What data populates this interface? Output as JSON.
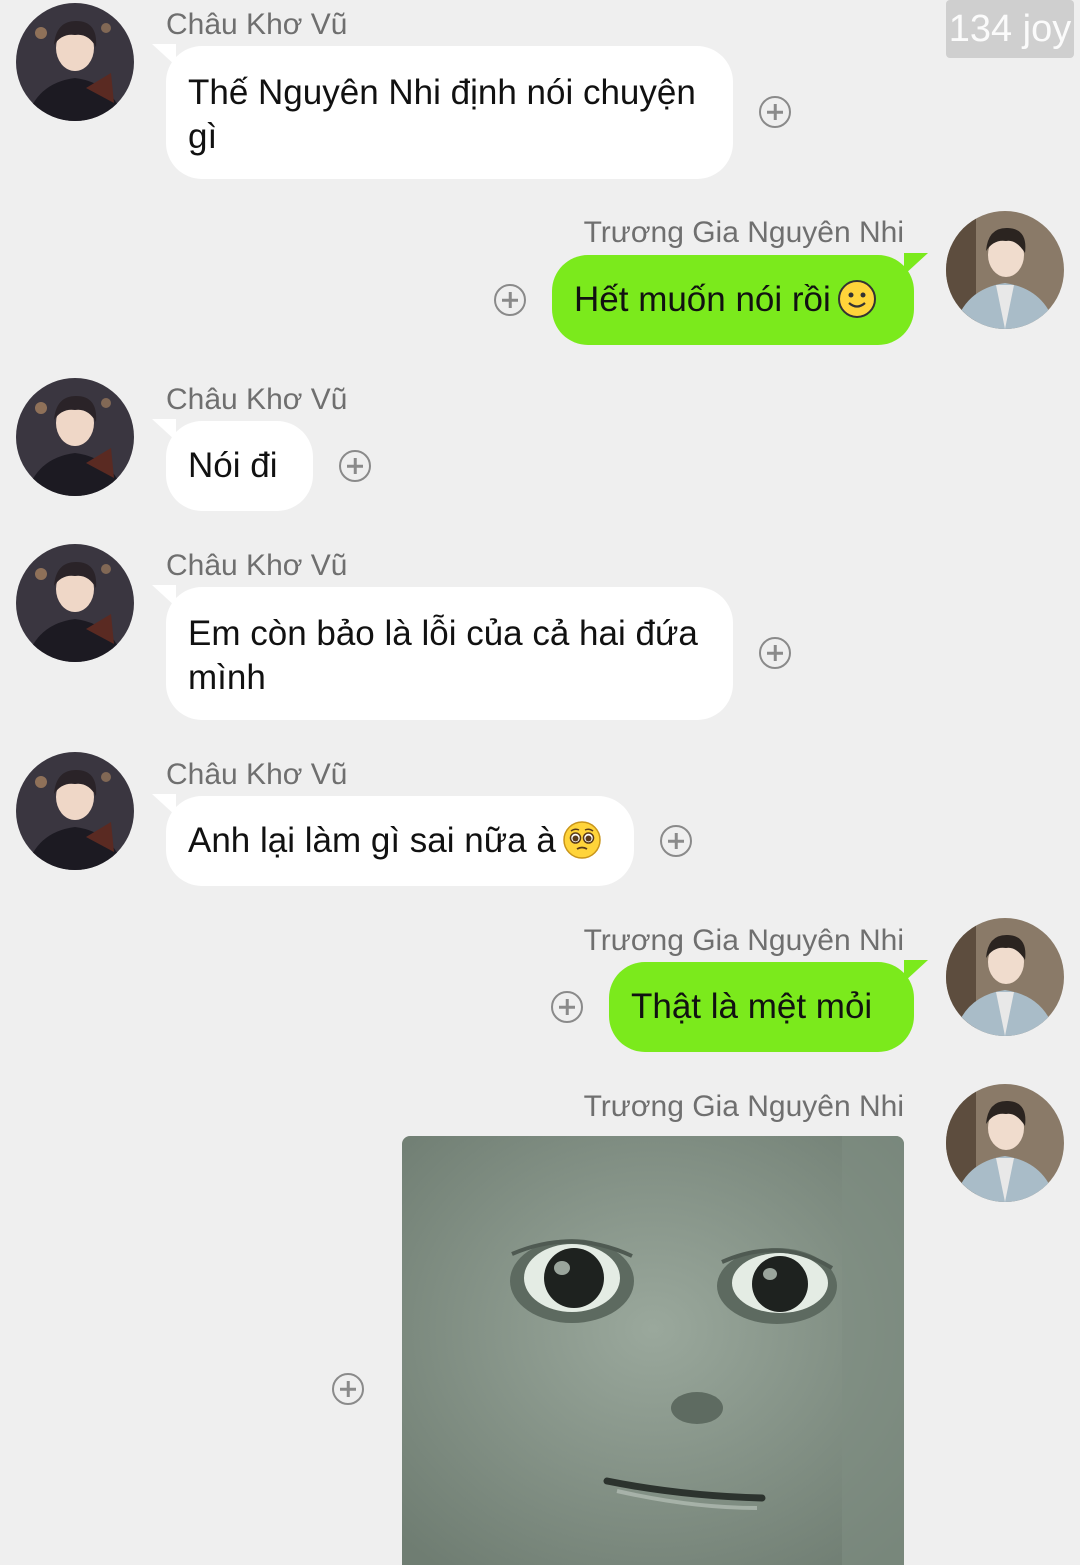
{
  "watermark": "134 joy",
  "contacts": {
    "left": {
      "name": "Châu Khơ Vũ",
      "avatar_icon": "profile-photo-dark-outfit"
    },
    "right": {
      "name": "Trương Gia Nguyên Nhi",
      "avatar_icon": "profile-photo-light-suit"
    }
  },
  "messages": [
    {
      "sender": "Châu Khơ Vũ",
      "side": "left",
      "text": "Thế Nguyên Nhi định nói chuyện gì"
    },
    {
      "sender": "Trương Gia Nguyên Nhi",
      "side": "right",
      "text": "Hết muốn nói rồi",
      "emoji": "slightly-smiling-face"
    },
    {
      "sender": "Châu Khơ Vũ",
      "side": "left",
      "text": "Nói đi"
    },
    {
      "sender": "Châu Khơ Vũ",
      "side": "left",
      "text": "Em còn bảo là lỗi của cả hai đứa mình"
    },
    {
      "sender": "Châu Khơ Vũ",
      "side": "left",
      "text": "Anh lại làm gì sai nữa à",
      "emoji": "pleading-face"
    },
    {
      "sender": "Trương Gia Nguyên Nhi",
      "side": "right",
      "text": "Thật là mệt mỏi"
    },
    {
      "sender": "Trương Gia Nguyên Nhi",
      "side": "right",
      "image": "meme-face-sticker"
    }
  ],
  "colors": {
    "background": "#efefef",
    "incoming_bubble": "#ffffff",
    "outgoing_bubble": "#7bea1c"
  }
}
